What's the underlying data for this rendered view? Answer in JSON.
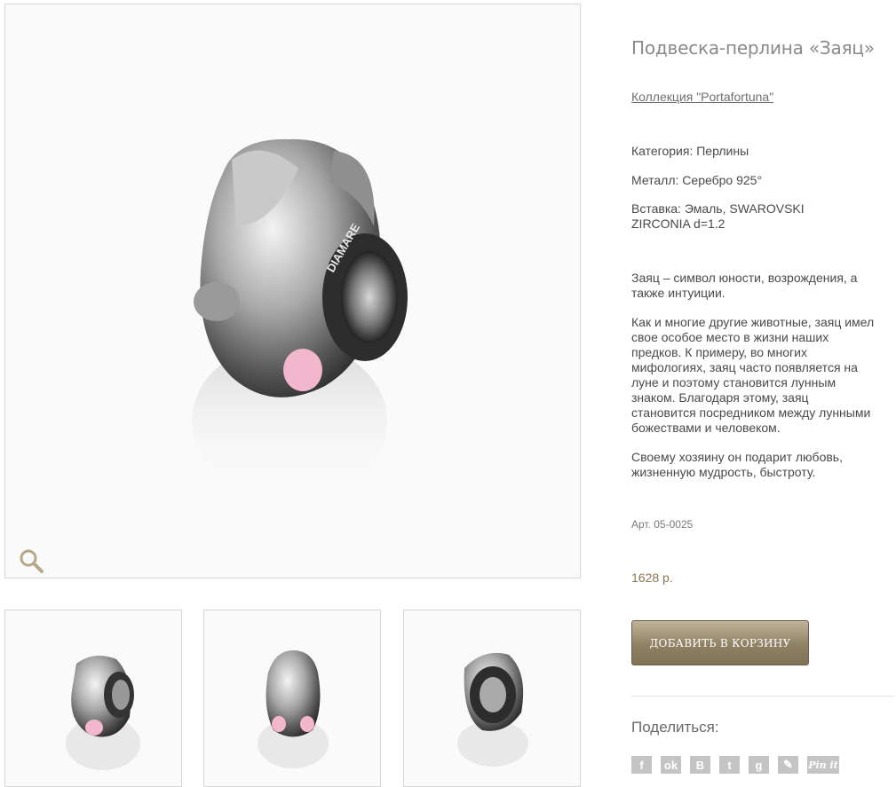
{
  "product": {
    "title": "Подвеска-перлина «Заяц»",
    "collection_link": "Коллекция \"Portafortuna\"",
    "category": "Категория: Перлины",
    "metal": "Металл: Серебро 925°",
    "insert": "Вставка: Эмаль, SWAROVSKI ZIRCONIA d=1.2",
    "description": [
      "Заяц – символ юности, возрождения, а также интуиции.",
      "Как и многие другие животные, заяц имел свое особое место в жизни наших предков. К примеру, во многих мифологиях, заяц часто появляется на луне и поэтому становится лунным знаком. Благодаря этому, заяц становится посредником между лунными божествами и человеком.",
      "Своему хозяину он подарит любовь, жизненную мудрость, быстроту."
    ],
    "article": "Арт. 05-0025",
    "price": "1628 р.",
    "brand_engraving": "DIAMARE"
  },
  "actions": {
    "add_to_cart": "Добавить в корзину"
  },
  "share": {
    "label": "Поделиться:",
    "buttons": [
      {
        "icon": "facebook-icon",
        "glyph": "f"
      },
      {
        "icon": "odnoklassniki-icon",
        "glyph": "ok"
      },
      {
        "icon": "vkontakte-icon",
        "glyph": "B"
      },
      {
        "icon": "twitter-icon",
        "glyph": "t"
      },
      {
        "icon": "google-plus-icon",
        "glyph": "g"
      },
      {
        "icon": "livejournal-icon",
        "glyph": "✎"
      },
      {
        "icon": "pinterest-icon",
        "glyph": "Pin it"
      }
    ]
  },
  "colors": {
    "enamel_pink": "#f2b6cd",
    "button_gold": "#8f8164",
    "price_color": "#8c7650"
  }
}
